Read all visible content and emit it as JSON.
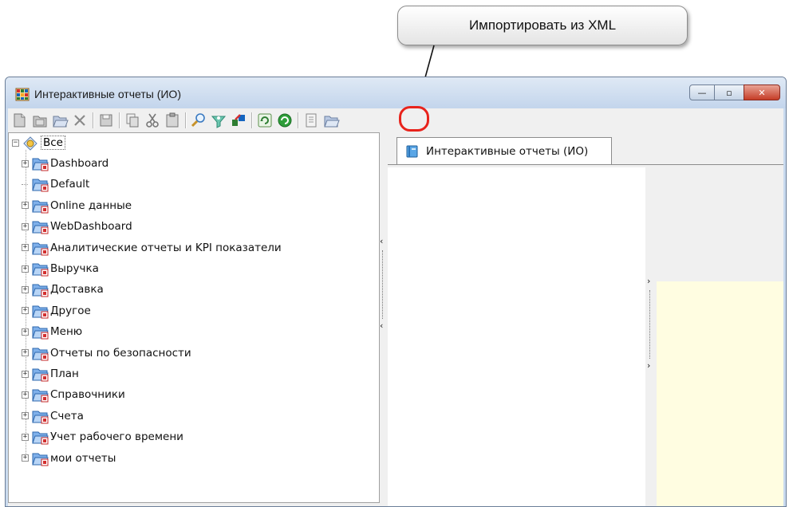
{
  "callout": {
    "text": "Импортировать из XML"
  },
  "window": {
    "title": "Интерактивные отчеты (ИО)",
    "controls": {
      "minimize": "—",
      "maximize": "▫",
      "close": "✕"
    }
  },
  "toolbar": {
    "buttons": [
      {
        "name": "new-report-icon"
      },
      {
        "name": "new-folder-icon"
      },
      {
        "name": "open-folder-icon"
      },
      {
        "name": "delete-icon"
      },
      {
        "sep": true
      },
      {
        "name": "save-icon"
      },
      {
        "sep": true
      },
      {
        "name": "copy-icon"
      },
      {
        "name": "cut-icon"
      },
      {
        "name": "paste-icon"
      },
      {
        "sep": true
      },
      {
        "name": "find-icon"
      },
      {
        "name": "filter-icon"
      },
      {
        "name": "move-icon"
      },
      {
        "sep": true
      },
      {
        "name": "refresh-icon"
      },
      {
        "name": "refresh-all-icon"
      },
      {
        "sep": true
      },
      {
        "name": "export-xml-icon"
      },
      {
        "name": "import-xml-icon"
      }
    ]
  },
  "tree": {
    "root": "Все",
    "items": [
      {
        "label": "Dashboard",
        "expandable": true
      },
      {
        "label": "Default",
        "expandable": false
      },
      {
        "label": "Online данные",
        "expandable": true
      },
      {
        "label": "WebDashboard",
        "expandable": true
      },
      {
        "label": "Аналитические отчеты и KPI показатели",
        "expandable": true
      },
      {
        "label": "Выручка",
        "expandable": true
      },
      {
        "label": "Доставка",
        "expandable": true
      },
      {
        "label": "Другое",
        "expandable": true
      },
      {
        "label": "Меню",
        "expandable": true
      },
      {
        "label": "Отчеты по безопасности",
        "expandable": true
      },
      {
        "label": "План",
        "expandable": true
      },
      {
        "label": "Справочники",
        "expandable": true
      },
      {
        "label": "Счета",
        "expandable": true
      },
      {
        "label": "Учет рабочего времени",
        "expandable": true
      },
      {
        "label": "мои отчеты",
        "expandable": true
      }
    ]
  },
  "tabs": [
    {
      "label": "Интерактивные отчеты (ИО)"
    }
  ],
  "colors": {
    "accent": "#e8231c",
    "window_frame": "#c9daee",
    "yellow_panel": "#fffde1"
  }
}
